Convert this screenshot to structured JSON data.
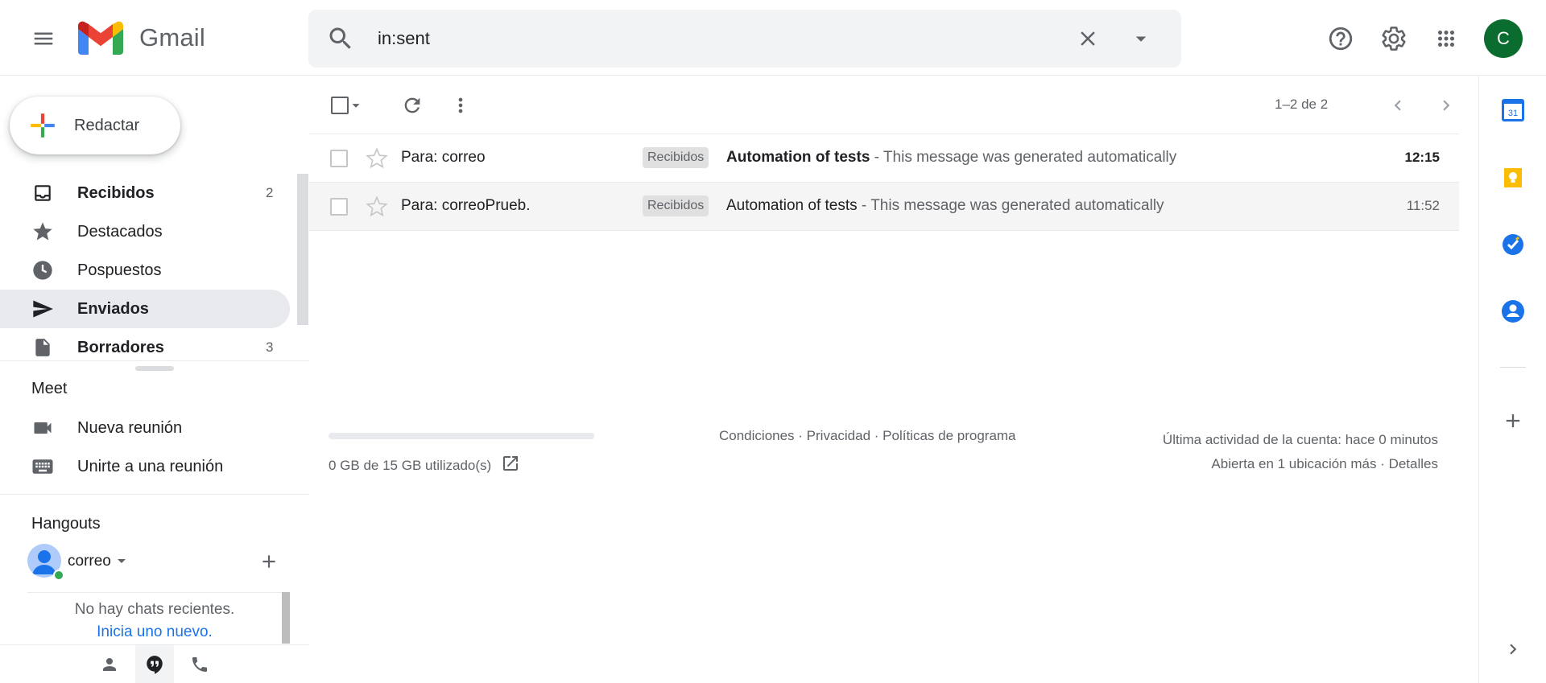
{
  "header": {
    "app_name": "Gmail",
    "search_value": "in:sent",
    "avatar_initial": "C"
  },
  "sidebar": {
    "compose_label": "Redactar",
    "items": [
      {
        "label": "Recibidos",
        "count": "2",
        "bold": true,
        "icon": "inbox-icon"
      },
      {
        "label": "Destacados",
        "count": "",
        "bold": false,
        "icon": "star-icon"
      },
      {
        "label": "Pospuestos",
        "count": "",
        "bold": false,
        "icon": "clock-icon"
      },
      {
        "label": "Enviados",
        "count": "",
        "bold": true,
        "icon": "send-icon",
        "active": true
      },
      {
        "label": "Borradores",
        "count": "3",
        "bold": true,
        "icon": "draft-icon"
      }
    ]
  },
  "meet": {
    "title": "Meet",
    "new_meeting": "Nueva reunión",
    "join_meeting": "Unirte a una reunión"
  },
  "hangouts": {
    "title": "Hangouts",
    "user_name": "correo",
    "no_chats": "No hay chats recientes.",
    "start_link": "Inicia uno nuevo."
  },
  "toolbar": {
    "pagination": "1–2 de 2"
  },
  "messages": [
    {
      "to": "Para: correo",
      "label": "Recibidos",
      "subject": "Automation of tests",
      "snippet": " - This message was generated automatically",
      "time": "12:15",
      "unread": true
    },
    {
      "to": "Para: correoPrueb.",
      "label": "Recibidos",
      "subject": "Automation of tests",
      "snippet": " - This message was generated automatically",
      "time": "11:52",
      "unread": false
    }
  ],
  "footer": {
    "storage": "0 GB de 15 GB utilizado(s)",
    "storage_used_fraction": 0,
    "terms": "Condiciones",
    "privacy": "Privacidad",
    "policies": "Políticas de programa",
    "sep": " · ",
    "last_activity": "Última actividad de la cuenta: hace 0 minutos",
    "open_in": "Abierta en 1 ubicación más",
    "details": "Detalles"
  },
  "colors": {
    "accent_blue": "#1a73e8",
    "avatar_green": "#0b6c2f",
    "keep_yellow": "#fbbc04"
  }
}
